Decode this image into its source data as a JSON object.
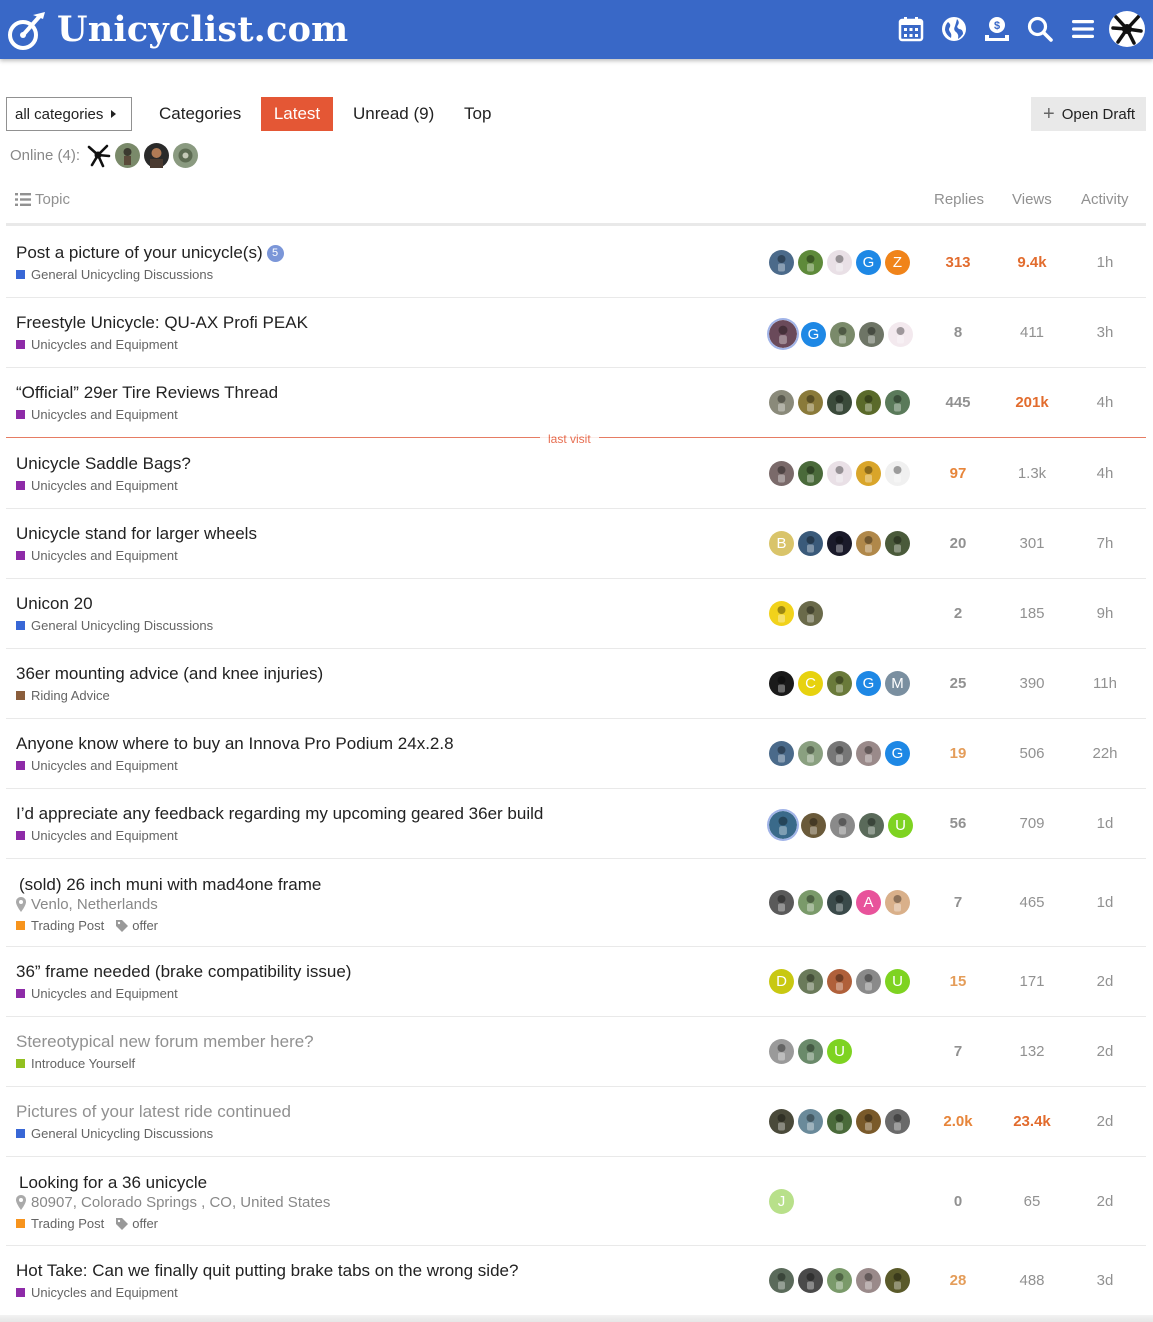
{
  "header": {
    "site_name": "Unicyclist.com",
    "icons": [
      "calendar-icon",
      "globe-icon",
      "donate-icon",
      "search-icon",
      "hamburger-menu-icon",
      "user-avatar"
    ]
  },
  "nav": {
    "category_dropdown": "all categories",
    "tabs": [
      "Categories",
      "Latest",
      "Unread (9)",
      "Top"
    ],
    "active_tab": "Latest",
    "open_draft": "Open Draft"
  },
  "online": {
    "label": "Online (4):"
  },
  "table": {
    "headers": {
      "topic": "Topic",
      "replies": "Replies",
      "views": "Views",
      "activity": "Activity"
    }
  },
  "last_visit_label": "last visit",
  "colors": {
    "header_bg": "#3968c7",
    "accent": "#e45735",
    "cat_general": "#3867d6",
    "cat_equipment": "#8e2ba8",
    "cat_riding": "#8b5e3c",
    "cat_trading": "#f7941d",
    "cat_introduce": "#92c020"
  },
  "topics": [
    {
      "title": "Post a picture of your unicycle(s)",
      "new_count": "5",
      "category": "General Unicycling Discussions",
      "replies": "313",
      "views": "9.4k",
      "activity": "1h"
    },
    {
      "title": "Freestyle Unicycle: QU-AX Profi PEAK",
      "category": "Unicycles and Equipment",
      "replies": "8",
      "views": "411",
      "activity": "3h"
    },
    {
      "title": "“Official” 29er Tire Reviews Thread",
      "category": "Unicycles and Equipment",
      "replies": "445",
      "views": "201k",
      "activity": "4h"
    },
    {
      "title": "Unicycle Saddle Bags?",
      "category": "Unicycles and Equipment",
      "replies": "97",
      "views": "1.3k",
      "activity": "4h"
    },
    {
      "title": "Unicycle stand for larger wheels",
      "category": "Unicycles and Equipment",
      "replies": "20",
      "views": "301",
      "activity": "7h"
    },
    {
      "title": "Unicon 20",
      "category": "General Unicycling Discussions",
      "replies": "2",
      "views": "185",
      "activity": "9h"
    },
    {
      "title": "36er mounting advice (and knee injuries)",
      "category": "Riding Advice",
      "replies": "25",
      "views": "390",
      "activity": "11h"
    },
    {
      "title": "Anyone know where to buy an Innova Pro Podium 24x.2.8",
      "category": "Unicycles and Equipment",
      "replies": "19",
      "views": "506",
      "activity": "22h"
    },
    {
      "title": "I’d appreciate any feedback regarding my upcoming geared 36er build",
      "category": "Unicycles and Equipment",
      "replies": "56",
      "views": "709",
      "activity": "1d"
    },
    {
      "title": "(sold) 26 inch muni with mad4one frame",
      "location": "Venlo, Netherlands",
      "category": "Trading Post",
      "tag": "offer",
      "replies": "7",
      "views": "465",
      "activity": "1d"
    },
    {
      "title": "36” frame needed (brake compatibility issue)",
      "category": "Unicycles and Equipment",
      "replies": "15",
      "views": "171",
      "activity": "2d"
    },
    {
      "title": "Stereotypical new forum member here?",
      "category": "Introduce Yourself",
      "replies": "7",
      "views": "132",
      "activity": "2d"
    },
    {
      "title": "Pictures of your latest ride continued",
      "category": "General Unicycling Discussions",
      "replies": "2.0k",
      "views": "23.4k",
      "activity": "2d"
    },
    {
      "title": "Looking for a 36 unicycle",
      "location": "80907, Colorado Springs , CO, United States",
      "category": "Trading Post",
      "tag": "offer",
      "replies": "0",
      "views": "65",
      "activity": "2d"
    },
    {
      "title": "Hot Take: Can we finally quit putting brake tabs on the wrong side?",
      "category": "Unicycles and Equipment",
      "replies": "28",
      "views": "488",
      "activity": "3d"
    }
  ],
  "letter_avatars": {
    "r0": [
      "G",
      "Z"
    ],
    "r1": [
      "G"
    ],
    "r4": [
      "B"
    ],
    "r6": [
      "C",
      "G",
      "M"
    ],
    "r7": [
      "G"
    ],
    "r8": [
      "U"
    ],
    "r9": [
      "A"
    ],
    "r10": [
      "D",
      "U"
    ],
    "r11": [
      "U"
    ],
    "r13": [
      "J"
    ]
  }
}
